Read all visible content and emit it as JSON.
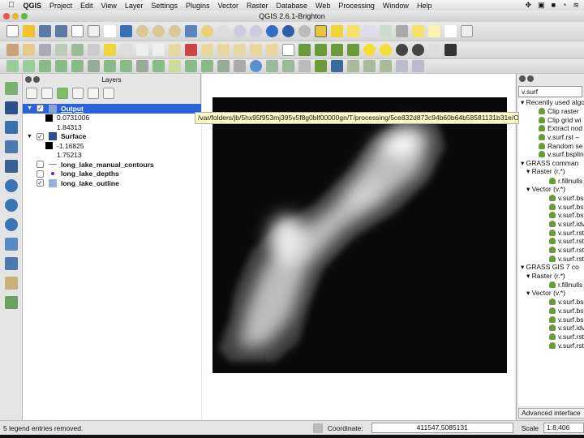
{
  "menubar": {
    "app": "QGIS",
    "items": [
      "Project",
      "Edit",
      "View",
      "Layer",
      "Settings",
      "Plugins",
      "Vector",
      "Raster",
      "Database",
      "Web",
      "Processing",
      "Window",
      "Help"
    ]
  },
  "window": {
    "title": "QGIS 2.6.1-Brighton"
  },
  "layers_panel": {
    "title": "Layers",
    "layers": [
      {
        "name": "Output",
        "checked": true,
        "selected": true,
        "min": "0.0731006",
        "max": "1.84313"
      },
      {
        "name": "Surface",
        "checked": true,
        "min": "-1.16825",
        "max": "1.75213"
      },
      {
        "name": "long_lake_manual_contours",
        "checked": false
      },
      {
        "name": "long_lake_depths",
        "checked": false
      },
      {
        "name": "long_lake_outline",
        "checked": true
      }
    ]
  },
  "tooltip": "/var/folders/jb/5hx95f953mj395v5f8g0blf00000gn/T/processing/5ce832d873c94b60b64b58581131b31e/OUTPUT.tif",
  "toolbox": {
    "search": "v.surf",
    "items": [
      "▾ Recently used algo",
      "Clip raster",
      "Clip grid wi",
      "Extract nod",
      "v.surf.rst – ",
      "Random se",
      "v.surf.bsplin",
      "▾ GRASS comman",
      "▾ Raster (r.*)",
      "r.fillnulls",
      "▾ Vector (v.*)",
      "v.surf.bs",
      "v.surf.bs",
      "v.surf.bs",
      "v.surf.idv",
      "v.surf.rst",
      "v.surf.rst",
      "v.surf.rst",
      "v.surf.rst",
      "▾ GRASS GIS 7 co",
      "▾ Raster (r.*)",
      "r.fillnulls",
      "▾ Vector (v.*)",
      "v.surf.bs",
      "v.surf.bs",
      "v.surf.bs",
      "v.surf.idv",
      "v.surf.rst",
      "v.surf.rst"
    ],
    "advanced": "Advanced interface"
  },
  "status": {
    "message": "5 legend entries removed.",
    "coordinate_label": "Coordinate:",
    "coordinate": "411547,5085131",
    "scale_label": "Scale",
    "scale": "1:8,406"
  },
  "colors": {
    "selection": "#2a63d8",
    "tooltip": "#fdfdc9"
  }
}
